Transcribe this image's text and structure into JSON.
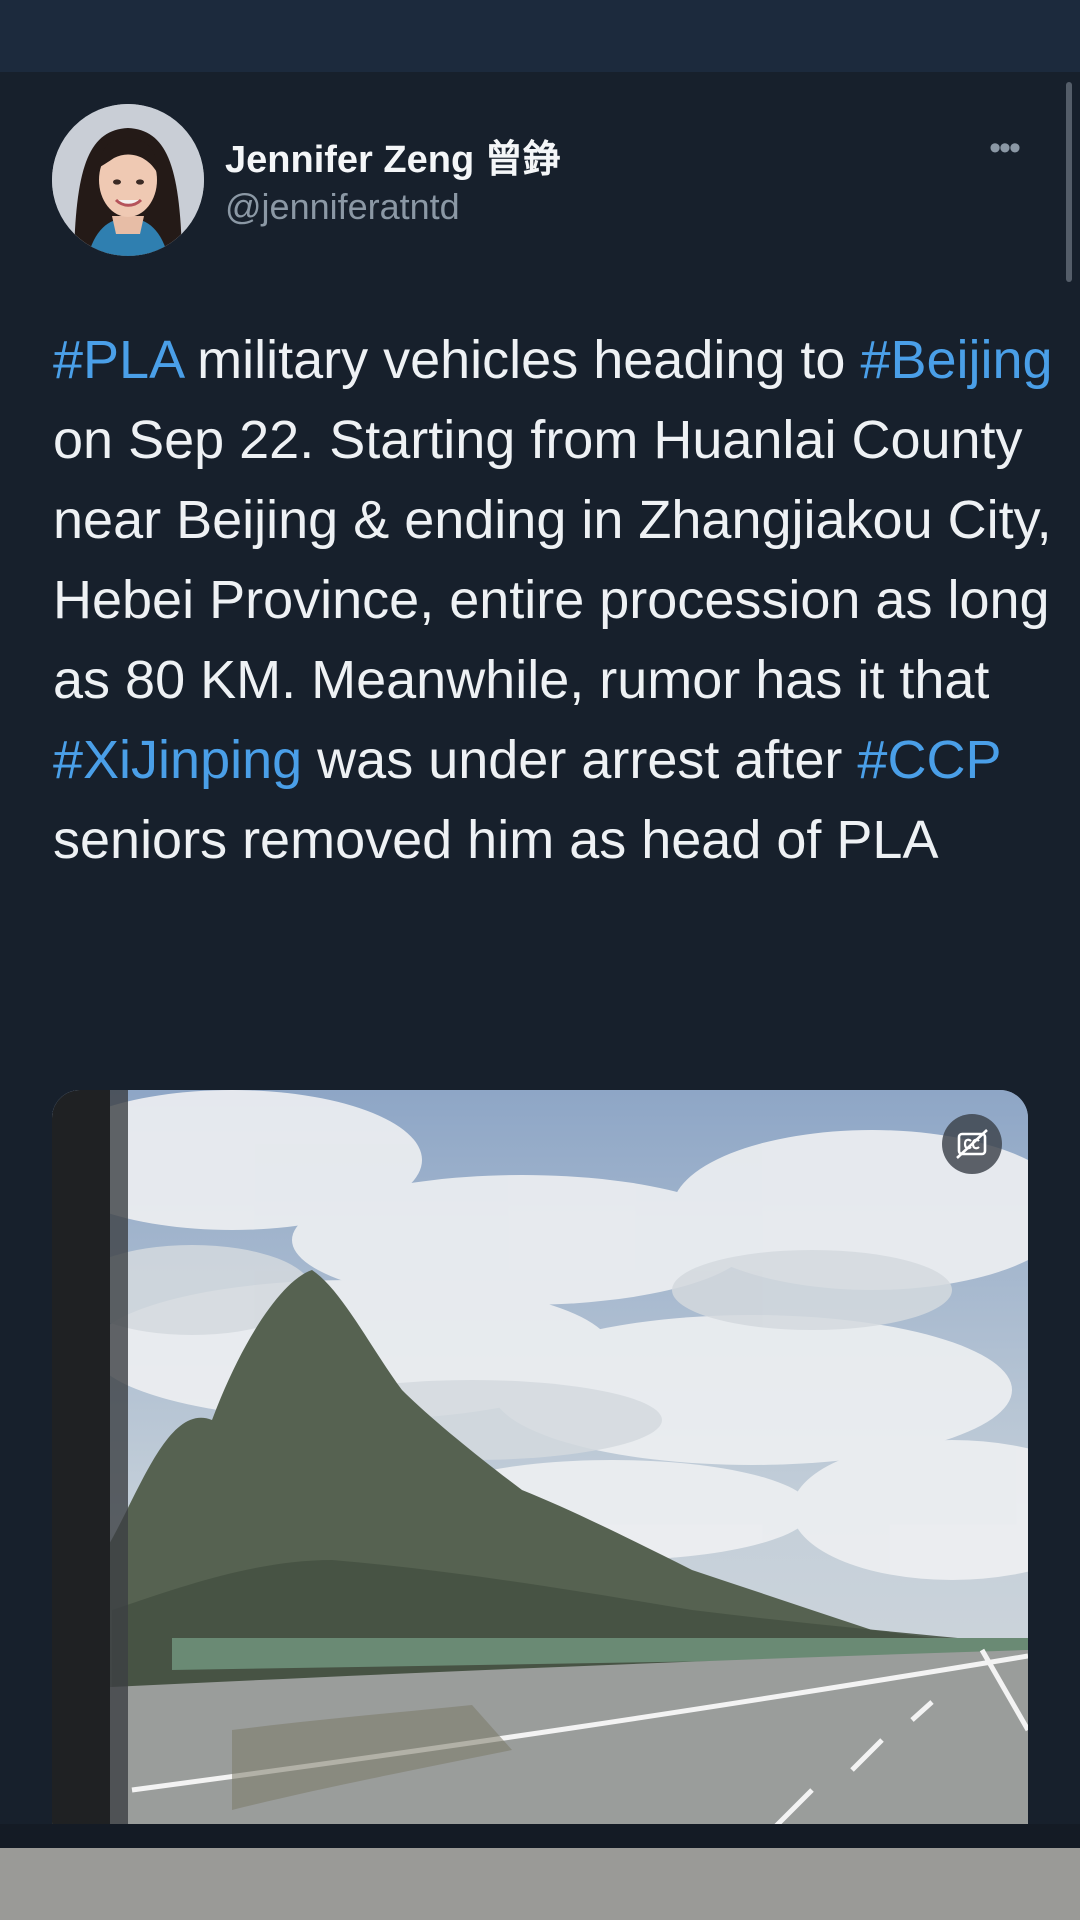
{
  "author": {
    "display_name": "Jennifer Zeng 曾錚",
    "handle": "@jenniferatntd"
  },
  "tweet": {
    "segments": [
      {
        "text": "#PLA",
        "hashtag": true
      },
      {
        "text": " military vehicles heading to ",
        "hashtag": false
      },
      {
        "text": "#Beijing",
        "hashtag": true
      },
      {
        "text": " on Sep 22. Starting from Huanlai County near Beijing & ending in Zhangjiakou City, Hebei Province, entire procession as long as 80 KM. Meanwhile, rumor has it that ",
        "hashtag": false
      },
      {
        "text": "#XiJinping",
        "hashtag": true
      },
      {
        "text": " was under arrest after ",
        "hashtag": false
      },
      {
        "text": "#CCP",
        "hashtag": true
      },
      {
        "text": " seniors removed him as head of PLA",
        "hashtag": false
      }
    ]
  },
  "icons": {
    "more": "more-horizontal-icon",
    "captions": "closed-captions-off-icon"
  },
  "colors": {
    "background": "#17202c",
    "hashtag": "#4a9fe8",
    "secondary_text": "#8b98a5",
    "primary_text": "#eef1f4"
  }
}
